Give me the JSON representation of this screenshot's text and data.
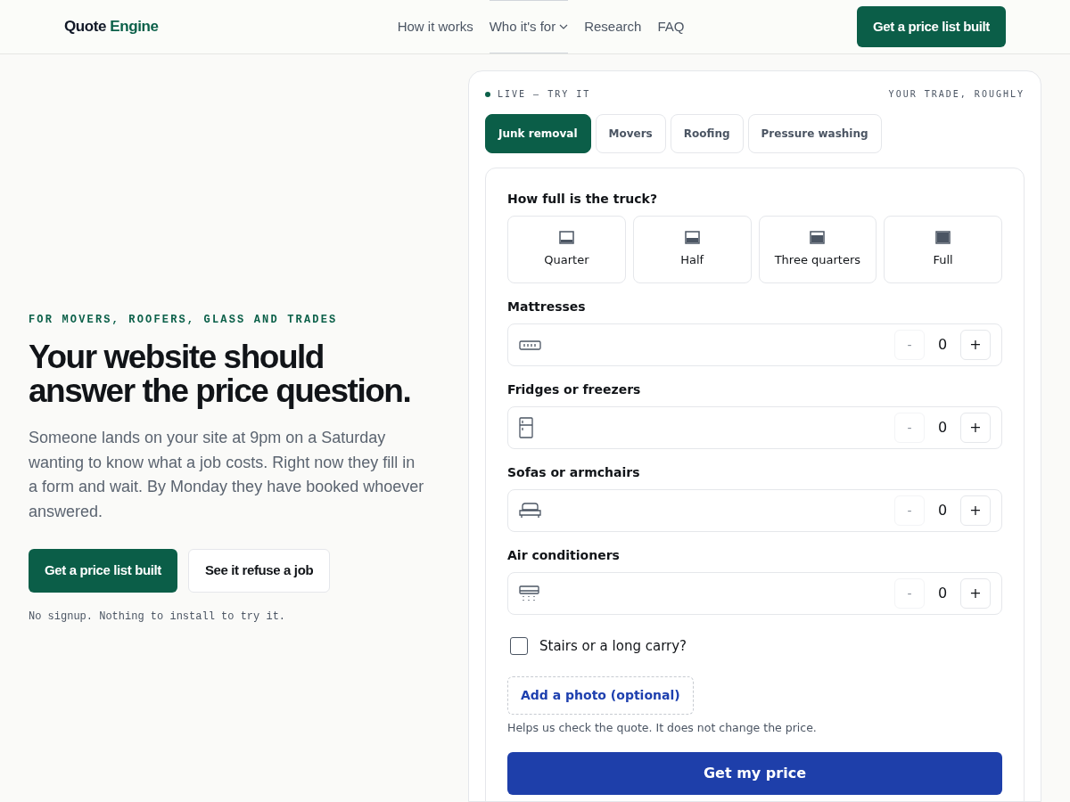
{
  "header": {
    "logo": {
      "first": "Quote",
      "second": "Engine"
    },
    "nav": [
      {
        "label": "How it works",
        "selected": false,
        "dropdown": false
      },
      {
        "label": "Who it's for",
        "selected": true,
        "dropdown": true
      },
      {
        "label": "Research",
        "selected": false,
        "dropdown": false
      },
      {
        "label": "FAQ",
        "selected": false,
        "dropdown": false
      }
    ],
    "cta": "Get a price list built"
  },
  "hero": {
    "eyebrow": "FOR MOVERS, ROOFERS, GLASS AND TRADES",
    "title": "Your website should answer the price question.",
    "body": "Someone lands on your site at 9pm on a Saturday wanting to know what a job costs. Right now they fill in a form and wait. By Monday they have booked whoever answered.",
    "primary": "Get a price list built",
    "secondary": "See it refuse a job",
    "note": "No signup. Nothing to install to try it."
  },
  "demo": {
    "live": "LIVE — TRY IT",
    "trade_label": "YOUR TRADE, ROUGHLY",
    "trades": [
      {
        "label": "Junk removal",
        "selected": true
      },
      {
        "label": "Movers",
        "selected": false
      },
      {
        "label": "Roofing",
        "selected": false
      },
      {
        "label": "Pressure washing",
        "selected": false
      }
    ],
    "question": "How full is the truck?",
    "loads": [
      {
        "label": "Quarter",
        "selected": false
      },
      {
        "label": "Half",
        "selected": false
      },
      {
        "label": "Three quarters",
        "selected": false
      },
      {
        "label": "Full",
        "selected": false
      }
    ],
    "counters": [
      {
        "label": "Mattresses",
        "kind": "mattress",
        "minus": "-",
        "value": "0",
        "plus": "+"
      },
      {
        "label": "Fridges or freezers",
        "kind": "fridge",
        "minus": "-",
        "value": "0",
        "plus": "+"
      },
      {
        "label": "Sofas or armchairs",
        "kind": "sofa",
        "minus": "-",
        "value": "0",
        "plus": "+"
      },
      {
        "label": "Air conditioners",
        "kind": "ac",
        "minus": "-",
        "value": "0",
        "plus": "+"
      }
    ],
    "stairs": {
      "label": "Stairs or a long carry?",
      "checked": false
    },
    "photo": {
      "label": "Add a photo (optional)",
      "hint": "Helps us check the quote. It does not change the price."
    },
    "submit": "Get my price"
  }
}
